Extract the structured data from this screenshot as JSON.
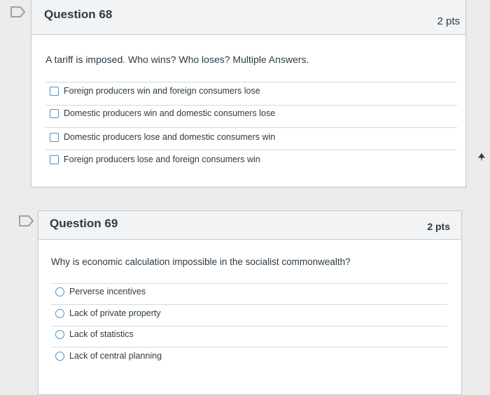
{
  "questions": [
    {
      "title": "Question 68",
      "points": "2 pts",
      "text": "A tariff is imposed. Who wins? Who loses? Multiple Answers.",
      "answer_type": "checkbox",
      "answers": [
        "Foreign producers win and foreign consumers lose",
        "Domestic producers win and domestic consumers lose",
        "Domestic producers lose and domestic consumers win",
        "Foreign producers lose and foreign consumers win"
      ]
    },
    {
      "title": "Question 69",
      "points": "2 pts",
      "text": "Why is economic calculation impossible in the socialist commonwealth?",
      "answer_type": "radio",
      "answers": [
        "Perverse incentives",
        "Lack of private property",
        "Lack of statistics",
        "Lack of central planning"
      ]
    }
  ],
  "colors": {
    "accent": "#4a90c2",
    "header_bg": "#f2f3f4",
    "text": "#2d3b45"
  },
  "icons": {
    "flag": "bookmark-flag-icon",
    "cursor": "mouse-pointer-icon"
  }
}
